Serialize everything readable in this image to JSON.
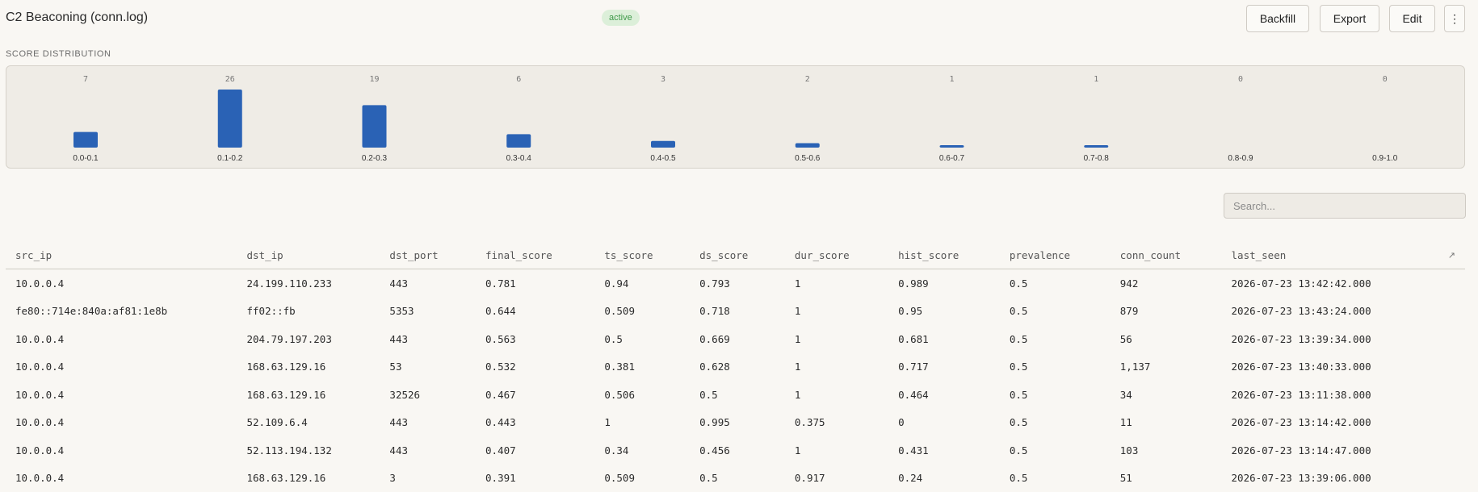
{
  "header": {
    "title": "C2 Beaconing (conn.log)",
    "status_badge": "active",
    "buttons": {
      "backfill": "Backfill",
      "export": "Export",
      "edit": "Edit",
      "more": "⋮"
    }
  },
  "score_distribution": {
    "label": "SCORE DISTRIBUTION"
  },
  "chart_data": {
    "type": "bar",
    "title": "",
    "categories": [
      "0.0-0.1",
      "0.1-0.2",
      "0.2-0.3",
      "0.3-0.4",
      "0.4-0.5",
      "0.5-0.6",
      "0.6-0.7",
      "0.7-0.8",
      "0.8-0.9",
      "0.9-1.0"
    ],
    "values": [
      7,
      26,
      19,
      6,
      3,
      2,
      1,
      1,
      0,
      0
    ],
    "ylim": [
      0,
      26
    ],
    "color": "#2a62b5",
    "grid": false
  },
  "search": {
    "placeholder": "Search..."
  },
  "table": {
    "columns": [
      "src_ip",
      "dst_ip",
      "dst_port",
      "final_score",
      "ts_score",
      "ds_score",
      "dur_score",
      "hist_score",
      "prevalence",
      "conn_count",
      "last_seen"
    ],
    "expand_icon": "↗",
    "rows": [
      [
        "10.0.0.4",
        "24.199.110.233",
        "443",
        "0.781",
        "0.94",
        "0.793",
        "1",
        "0.989",
        "0.5",
        "942",
        "2026-07-23 13:42:42.000"
      ],
      [
        "fe80::714e:840a:af81:1e8b",
        "ff02::fb",
        "5353",
        "0.644",
        "0.509",
        "0.718",
        "1",
        "0.95",
        "0.5",
        "879",
        "2026-07-23 13:43:24.000"
      ],
      [
        "10.0.0.4",
        "204.79.197.203",
        "443",
        "0.563",
        "0.5",
        "0.669",
        "1",
        "0.681",
        "0.5",
        "56",
        "2026-07-23 13:39:34.000"
      ],
      [
        "10.0.0.4",
        "168.63.129.16",
        "53",
        "0.532",
        "0.381",
        "0.628",
        "1",
        "0.717",
        "0.5",
        "1,137",
        "2026-07-23 13:40:33.000"
      ],
      [
        "10.0.0.4",
        "168.63.129.16",
        "32526",
        "0.467",
        "0.506",
        "0.5",
        "1",
        "0.464",
        "0.5",
        "34",
        "2026-07-23 13:11:38.000"
      ],
      [
        "10.0.0.4",
        "52.109.6.4",
        "443",
        "0.443",
        "1",
        "0.995",
        "0.375",
        "0",
        "0.5",
        "11",
        "2026-07-23 13:14:42.000"
      ],
      [
        "10.0.0.4",
        "52.113.194.132",
        "443",
        "0.407",
        "0.34",
        "0.456",
        "1",
        "0.431",
        "0.5",
        "103",
        "2026-07-23 13:14:47.000"
      ],
      [
        "10.0.0.4",
        "168.63.129.16",
        "3",
        "0.391",
        "0.509",
        "0.5",
        "0.917",
        "0.24",
        "0.5",
        "51",
        "2026-07-23 13:39:06.000"
      ]
    ]
  }
}
